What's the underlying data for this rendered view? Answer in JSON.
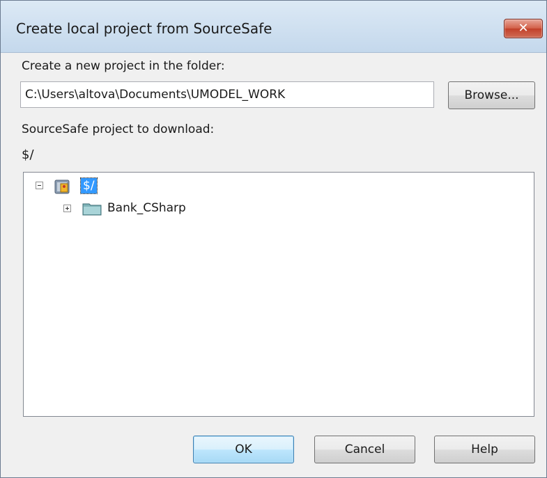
{
  "window": {
    "title": "Create local project from SourceSafe",
    "close_label": "✕"
  },
  "folder_section": {
    "label": "Create a new project in the folder:",
    "path_value": "C:\\Users\\altova\\Documents\\UMODEL_WORK",
    "browse_label": "Browse..."
  },
  "project_section": {
    "label": "SourceSafe project to download:",
    "selected_path": "$/"
  },
  "tree": {
    "root": {
      "label": "$/",
      "icon": "sourcesafe-database-icon",
      "expanded": true,
      "selected": true
    },
    "children": [
      {
        "label": "Bank_CSharp",
        "icon": "folder-icon",
        "expanded": false
      }
    ]
  },
  "buttons": {
    "ok_label": "OK",
    "cancel_label": "Cancel",
    "help_label": "Help"
  },
  "colors": {
    "selection": "#3399ff",
    "close_button": "#c2402a",
    "titlebar": "#c4d8ec"
  }
}
